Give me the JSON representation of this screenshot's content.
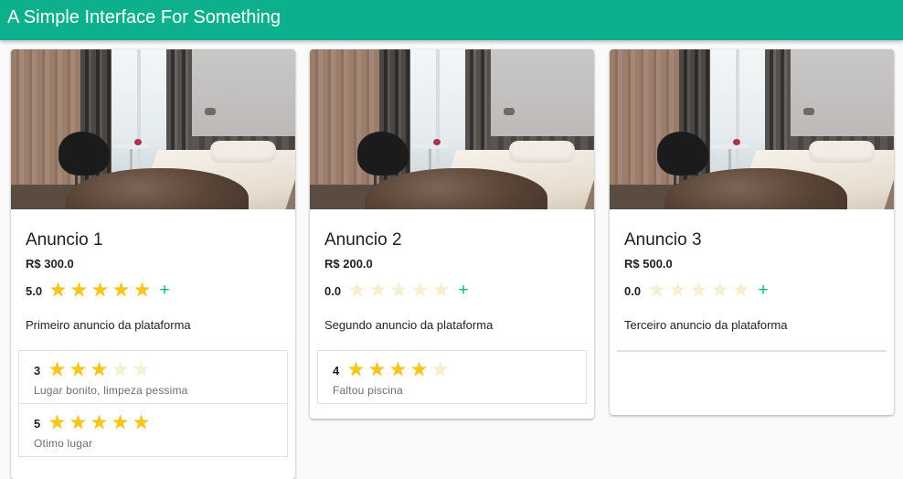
{
  "app": {
    "title": "A Simple Interface For Something"
  },
  "colors": {
    "primary": "#0cb08d",
    "star_on": "#f5c71a",
    "star_off": "#f6f0d2"
  },
  "icons": {
    "star": "star-icon",
    "add": "plus-icon"
  },
  "cards": [
    {
      "title": "Anuncio 1",
      "price": "R$ 300.0",
      "rating": "5.0",
      "rating_value": 5,
      "add_label": "+",
      "description": "Primeiro anuncio da plataforma",
      "reviews": [
        {
          "score": "3",
          "score_value": 3,
          "text": "Lugar bonito, limpeza pessima"
        },
        {
          "score": "5",
          "score_value": 5,
          "text": "Otimo lugar"
        }
      ]
    },
    {
      "title": "Anuncio 2",
      "price": "R$ 200.0",
      "rating": "0.0",
      "rating_value": 0,
      "add_label": "+",
      "description": "Segundo anuncio da plataforma",
      "reviews": [
        {
          "score": "4",
          "score_value": 4,
          "text": "Faltou piscina"
        }
      ]
    },
    {
      "title": "Anuncio 3",
      "price": "R$ 500.0",
      "rating": "0.0",
      "rating_value": 0,
      "add_label": "+",
      "description": "Terceiro anuncio da plataforma",
      "reviews": []
    }
  ]
}
